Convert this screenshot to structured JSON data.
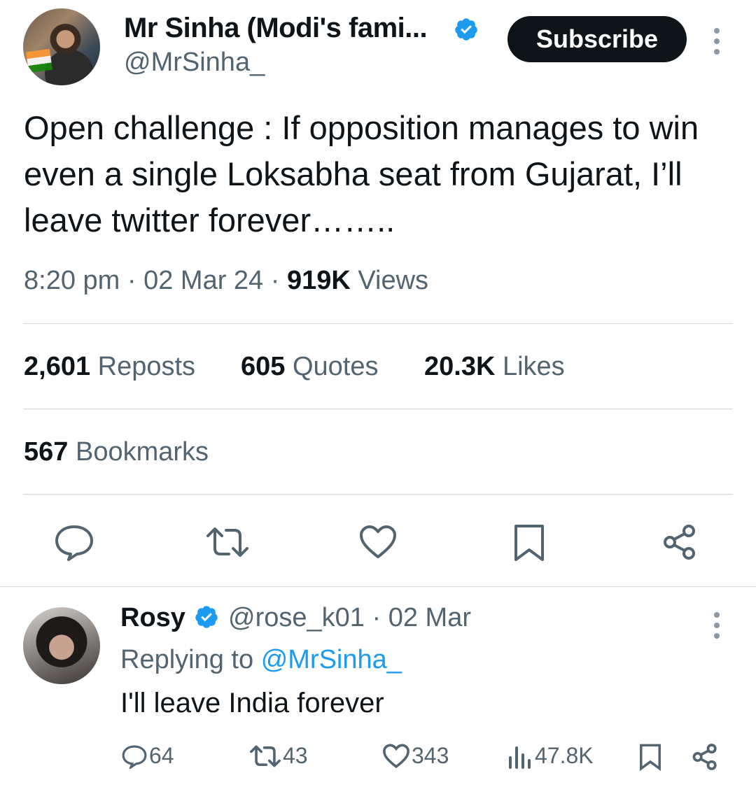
{
  "tweet": {
    "author_name": "Mr Sinha (Modi's fami...",
    "handle": "@MrSinha_",
    "subscribe_label": "Subscribe",
    "text": "Open challenge : If opposition manages to win even a single Loksabha seat from Gujarat, I’ll leave twitter forever……..",
    "time": "8:20 pm",
    "date": "02 Mar 24",
    "views_count": "919K",
    "views_label": "Views",
    "reposts_count": "2,601",
    "reposts_label": "Reposts",
    "quotes_count": "605",
    "quotes_label": "Quotes",
    "likes_count": "20.3K",
    "likes_label": "Likes",
    "bookmarks_count": "567",
    "bookmarks_label": "Bookmarks",
    "actions": [
      "reply-icon",
      "repost-icon",
      "like-icon",
      "bookmark-icon",
      "share-icon"
    ]
  },
  "reply": {
    "name": "Rosy",
    "handle": "@rose_k01",
    "date": "02 Mar",
    "replying_prefix": "Replying to",
    "replying_to": "@MrSinha_",
    "text": "I'll leave India forever",
    "reply_count": "64",
    "repost_count": "43",
    "like_count": "343",
    "views_count": "47.8K"
  },
  "colors": {
    "text": "#0f1419",
    "secondary": "#536471",
    "accent": "#1d9bf0",
    "verified": "#1d9bf0",
    "divider": "#cfd9de"
  }
}
